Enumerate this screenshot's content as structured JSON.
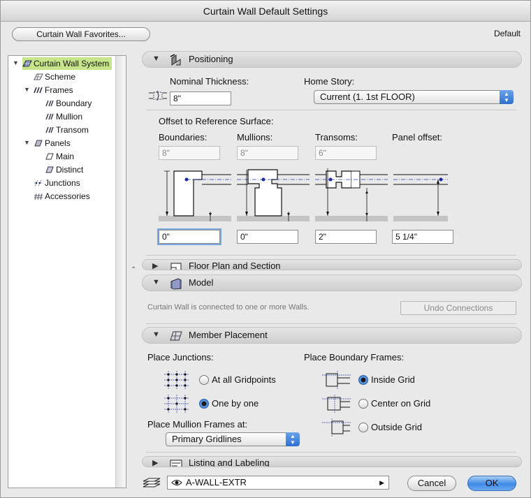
{
  "window": {
    "title": "Curtain Wall Default Settings"
  },
  "favorites_button": "Curtain Wall Favorites...",
  "default_label": "Default",
  "tree": {
    "items": [
      {
        "label": "Curtain Wall System",
        "icon": "curtain-wall-icon"
      },
      {
        "label": "Scheme",
        "icon": "scheme-icon"
      },
      {
        "label": "Frames",
        "icon": "frames-icon"
      },
      {
        "label": "Boundary",
        "icon": "frame-icon"
      },
      {
        "label": "Mullion",
        "icon": "frame-icon"
      },
      {
        "label": "Transom",
        "icon": "frame-icon"
      },
      {
        "label": "Panels",
        "icon": "panels-icon"
      },
      {
        "label": "Main",
        "icon": "panel-icon"
      },
      {
        "label": "Distinct",
        "icon": "panel-icon"
      },
      {
        "label": "Junctions",
        "icon": "junctions-icon"
      },
      {
        "label": "Accessories",
        "icon": "accessories-icon"
      }
    ]
  },
  "positioning": {
    "title": "Positioning",
    "nominal_thickness_label": "Nominal Thickness:",
    "nominal_thickness_value": "8\"",
    "home_story_label": "Home Story:",
    "home_story_value": "Current (1. 1st FLOOR)",
    "offset_label": "Offset to Reference Surface:",
    "columns": [
      {
        "label": "Boundaries:",
        "value": "8\"",
        "offset": "0\""
      },
      {
        "label": "Mullions:",
        "value": "8\"",
        "offset": "0\""
      },
      {
        "label": "Transoms:",
        "value": "6\"",
        "offset": "2\""
      },
      {
        "label": "Panel offset:",
        "value": "",
        "offset": "5 1/4\""
      }
    ]
  },
  "floor_plan": {
    "title": "Floor Plan and Section"
  },
  "model": {
    "title": "Model",
    "info": "Curtain Wall is connected to one or more Walls.",
    "undo_button": "Undo Connections"
  },
  "member_placement": {
    "title": "Member Placement",
    "junctions_label": "Place Junctions:",
    "junction_options": [
      "At all Gridpoints",
      "One by one"
    ],
    "junction_selected": 1,
    "boundary_label": "Place Boundary Frames:",
    "boundary_options": [
      "Inside Grid",
      "Center on Grid",
      "Outside Grid"
    ],
    "boundary_selected": 0,
    "mullion_label": "Place Mullion Frames at:",
    "mullion_value": "Primary Gridlines"
  },
  "listing": {
    "title": "Listing and Labeling"
  },
  "footer": {
    "layer": "A-WALL-EXTR",
    "cancel": "Cancel",
    "ok": "OK"
  },
  "colors": {
    "accent": "#3f8ae6",
    "tree_selection": "#c7e68c"
  }
}
